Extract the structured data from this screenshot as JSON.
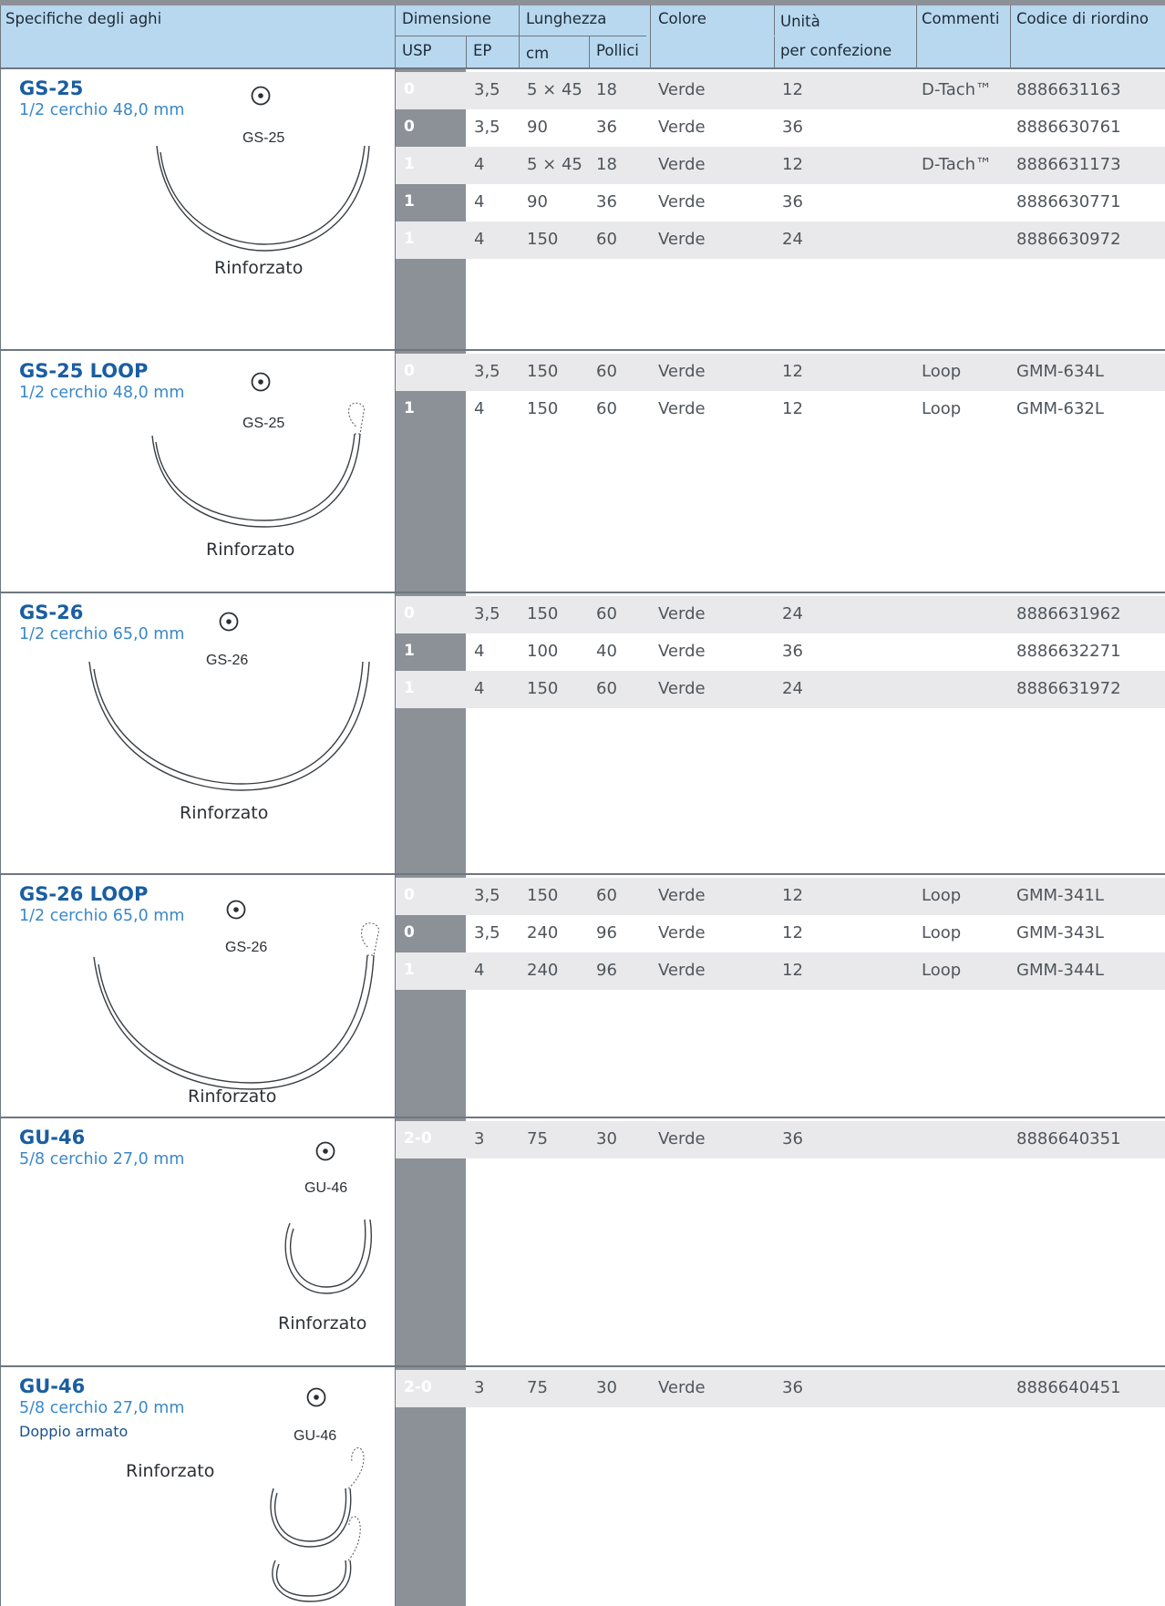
{
  "header": {
    "spec": "Specifiche degli aghi",
    "dimensione": "Dimensione",
    "usp": "USP",
    "ep": "EP",
    "lunghezza": "Lunghezza",
    "cm": "cm",
    "pollici": "Pollici",
    "colore": "Colore",
    "unita": "Unità",
    "per_confezione": "per confezione",
    "commenti": "Commenti",
    "codice": "Codice di riordino"
  },
  "sections": [
    {
      "title": "GS-25",
      "subtitle": "1/2 cerchio   48,0 mm",
      "code": "GS-25",
      "note": "Rinforzato",
      "rows": [
        {
          "usp": "0",
          "ep": "3,5",
          "cm": "5 × 45",
          "inch": "18",
          "color": "Verde",
          "units": "12",
          "comment": "D-Tach™",
          "code": "8886631163"
        },
        {
          "usp": "0",
          "ep": "3,5",
          "cm": "90",
          "inch": "36",
          "color": "Verde",
          "units": "36",
          "comment": "",
          "code": "8886630761"
        },
        {
          "usp": "1",
          "ep": "4",
          "cm": "5 × 45",
          "inch": "18",
          "color": "Verde",
          "units": "12",
          "comment": "D-Tach™",
          "code": "8886631173"
        },
        {
          "usp": "1",
          "ep": "4",
          "cm": "90",
          "inch": "36",
          "color": "Verde",
          "units": "36",
          "comment": "",
          "code": "8886630771"
        },
        {
          "usp": "1",
          "ep": "4",
          "cm": "150",
          "inch": "60",
          "color": "Verde",
          "units": "24",
          "comment": "",
          "code": "8886630972"
        }
      ]
    },
    {
      "title": "GS-25 LOOP",
      "subtitle": "1/2 cerchio   48,0 mm",
      "code": "GS-25",
      "note": "Rinforzato",
      "rows": [
        {
          "usp": "0",
          "ep": "3,5",
          "cm": "150",
          "inch": "60",
          "color": "Verde",
          "units": "12",
          "comment": "Loop",
          "code": "GMM-634L"
        },
        {
          "usp": "1",
          "ep": "4",
          "cm": "150",
          "inch": "60",
          "color": "Verde",
          "units": "12",
          "comment": "Loop",
          "code": "GMM-632L"
        }
      ]
    },
    {
      "title": "GS-26",
      "subtitle": "1/2 cerchio   65,0 mm",
      "code": "GS-26",
      "note": "Rinforzato",
      "rows": [
        {
          "usp": "0",
          "ep": "3,5",
          "cm": "150",
          "inch": "60",
          "color": "Verde",
          "units": "24",
          "comment": "",
          "code": "8886631962"
        },
        {
          "usp": "1",
          "ep": "4",
          "cm": "100",
          "inch": "40",
          "color": "Verde",
          "units": "36",
          "comment": "",
          "code": "8886632271"
        },
        {
          "usp": "1",
          "ep": "4",
          "cm": "150",
          "inch": "60",
          "color": "Verde",
          "units": "24",
          "comment": "",
          "code": "8886631972"
        }
      ]
    },
    {
      "title": "GS-26 LOOP",
      "subtitle": "1/2 cerchio   65,0 mm",
      "code": "GS-26",
      "note": "Rinforzato",
      "rows": [
        {
          "usp": "0",
          "ep": "3,5",
          "cm": "150",
          "inch": "60",
          "color": "Verde",
          "units": "12",
          "comment": "Loop",
          "code": "GMM-341L"
        },
        {
          "usp": "0",
          "ep": "3,5",
          "cm": "240",
          "inch": "96",
          "color": "Verde",
          "units": "12",
          "comment": "Loop",
          "code": "GMM-343L"
        },
        {
          "usp": "1",
          "ep": "4",
          "cm": "240",
          "inch": "96",
          "color": "Verde",
          "units": "12",
          "comment": "Loop",
          "code": "GMM-344L"
        }
      ]
    },
    {
      "title": "GU-46",
      "subtitle": "5/8 cerchio   27,0 mm",
      "code": "GU-46",
      "note": "Rinforzato",
      "rows": [
        {
          "usp": "2-0",
          "ep": "3",
          "cm": "75",
          "inch": "30",
          "color": "Verde",
          "units": "36",
          "comment": "",
          "code": "8886640351"
        }
      ]
    },
    {
      "title": "GU-46",
      "subtitle": "5/8 cerchio   27,0 mm",
      "extra": "Doppio armato",
      "code": "GU-46",
      "note": "Rinforzato",
      "rows": [
        {
          "usp": "2-0",
          "ep": "3",
          "cm": "75",
          "inch": "30",
          "color": "Verde",
          "units": "36",
          "comment": "",
          "code": "8886640451"
        }
      ]
    }
  ]
}
